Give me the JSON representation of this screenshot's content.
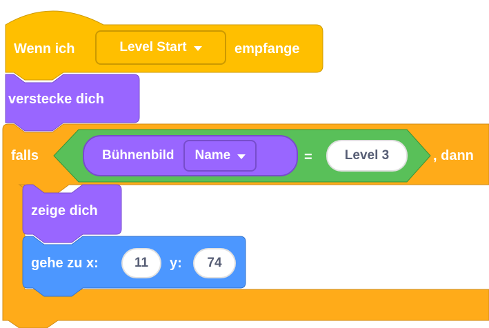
{
  "script": {
    "event_hat": {
      "prefix": "Wenn ich",
      "broadcast_dropdown": "Level Start",
      "suffix": "empfange"
    },
    "hide_block": {
      "label": "verstecke dich"
    },
    "if_block": {
      "prefix": "falls",
      "suffix": ", dann",
      "condition": {
        "operator": "=",
        "left": {
          "reporter_label": "Bühnenbild",
          "dropdown": "Name"
        },
        "right_value": "Level 3"
      }
    },
    "show_block": {
      "label": "zeige dich"
    },
    "goto_block": {
      "label": "gehe zu x:",
      "x_value": "11",
      "y_label": "y:",
      "y_value": "74"
    }
  },
  "colors": {
    "events": "#ffbf00",
    "events_border": "#cc9900",
    "looks": "#9966ff",
    "looks_border": "#774dcb",
    "control": "#ffab19",
    "control_border": "#cf8b17",
    "operators": "#59c059",
    "operators_border": "#389438",
    "motion": "#4c97ff",
    "motion_border": "#3373cc",
    "text_on_block": "#ffffff",
    "value_text": "#575e75"
  }
}
